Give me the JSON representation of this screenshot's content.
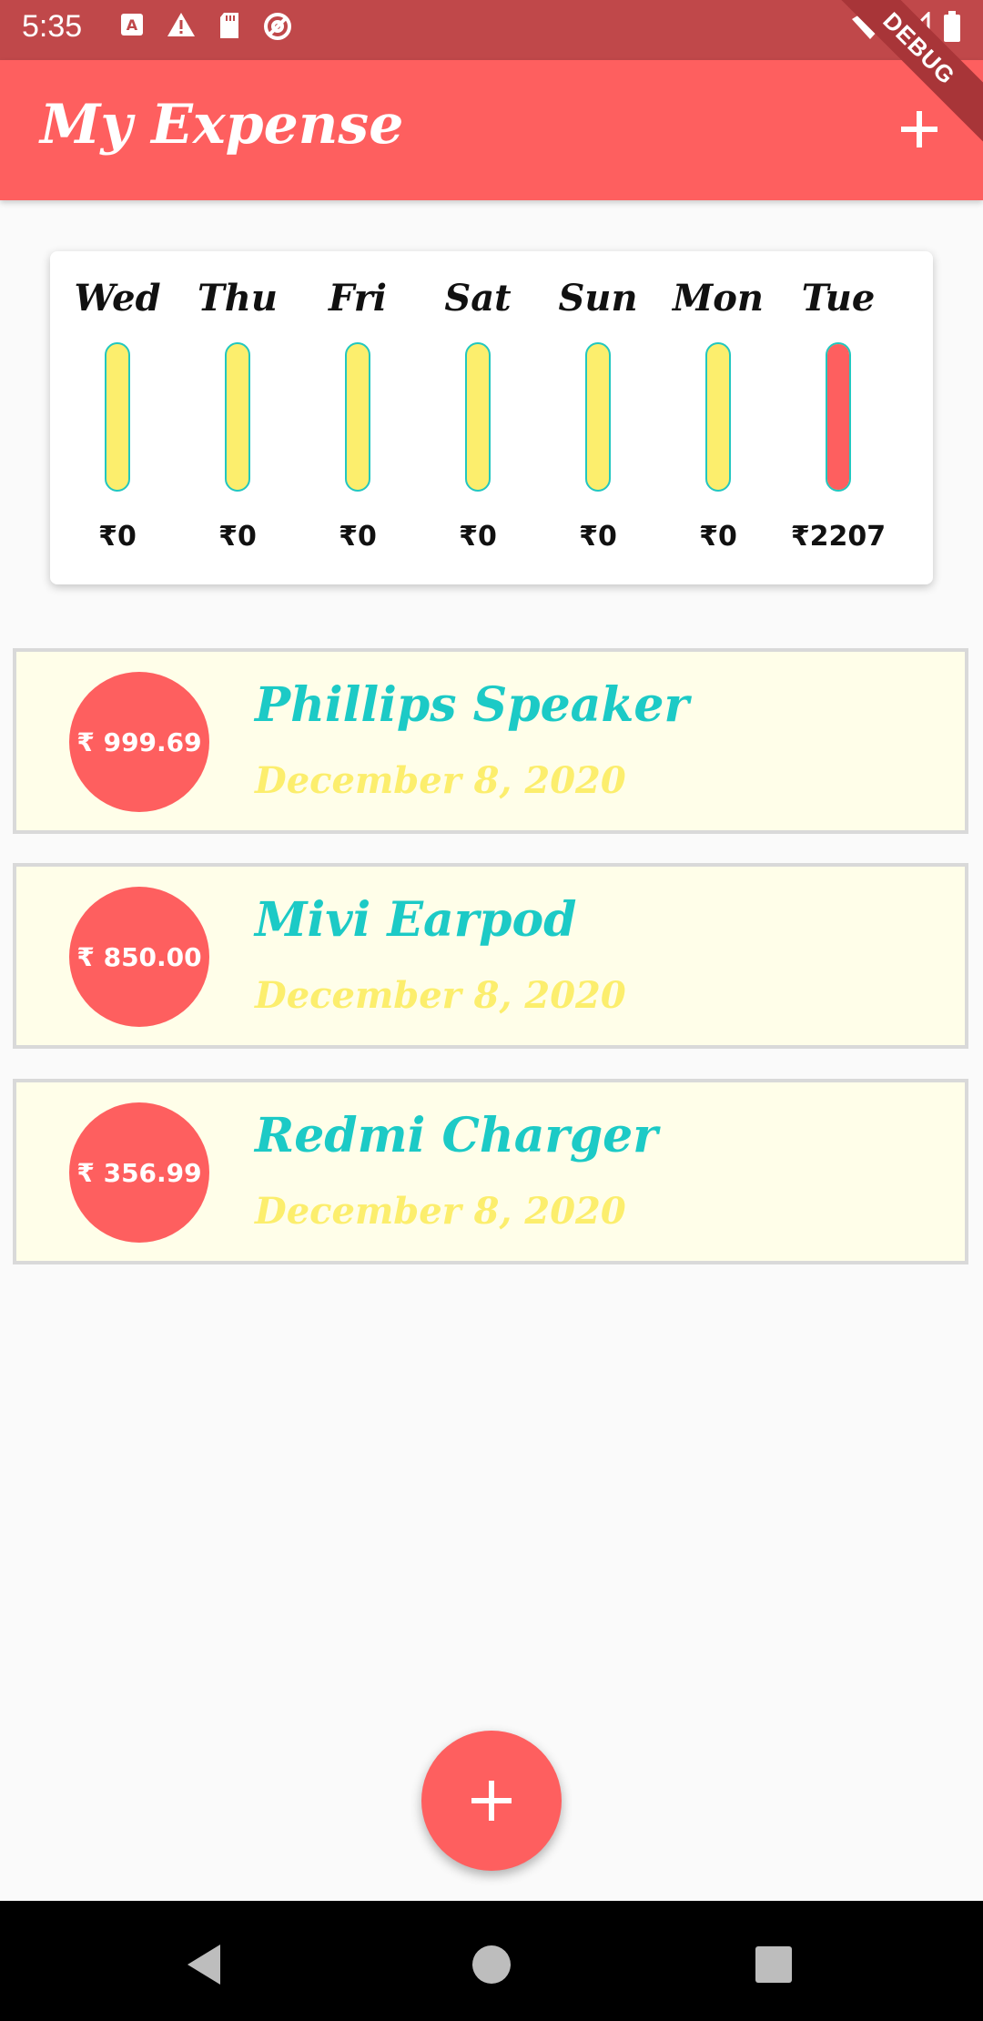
{
  "status_bar": {
    "time": "5:35",
    "left_icons": [
      "a-notification-icon",
      "warning-icon",
      "sd-card-icon",
      "at-sign-icon"
    ],
    "right_icons": [
      "wifi-icon",
      "cell-signal-icon",
      "battery-icon"
    ]
  },
  "debug_banner": "DEBUG",
  "app_bar": {
    "title": "My Expense",
    "action_icon": "add-icon"
  },
  "weekly_chart": {
    "days": [
      {
        "day": "Wed",
        "amount": "₹0",
        "fill": 0
      },
      {
        "day": "Thu",
        "amount": "₹0",
        "fill": 0
      },
      {
        "day": "Fri",
        "amount": "₹0",
        "fill": 0
      },
      {
        "day": "Sat",
        "amount": "₹0",
        "fill": 0
      },
      {
        "day": "Sun",
        "amount": "₹0",
        "fill": 0
      },
      {
        "day": "Mon",
        "amount": "₹0",
        "fill": 0
      },
      {
        "day": "Tue",
        "amount": "₹2207",
        "fill": 1
      }
    ],
    "colors": {
      "track": "#fcee6d",
      "track_border": "#22c7c0",
      "fill": "#fe5f5f"
    }
  },
  "transactions": [
    {
      "amount": "₹ 999.69",
      "title": "Phillips Speaker",
      "date": "December 8, 2020"
    },
    {
      "amount": "₹ 850.00",
      "title": "Mivi Earpod",
      "date": "December 8, 2020"
    },
    {
      "amount": "₹ 356.99",
      "title": "Redmi Charger",
      "date": "December 8, 2020"
    }
  ],
  "fab": {
    "icon": "add-icon"
  },
  "nav_bar": {
    "icons": [
      "back-icon",
      "home-icon",
      "recents-icon"
    ]
  },
  "colors": {
    "primary": "#fe5f5f",
    "status_bar": "#c0484a",
    "title_accent": "#1ccac6",
    "date_accent": "#fcee6d",
    "card_bg": "#fffee9"
  }
}
